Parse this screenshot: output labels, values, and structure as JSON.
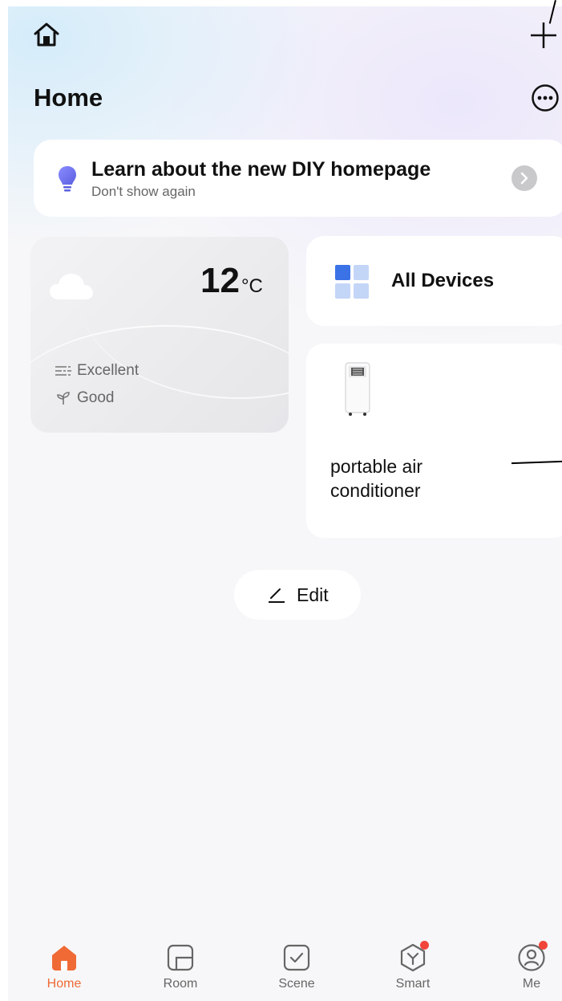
{
  "header": {
    "title": "Home"
  },
  "banner": {
    "title": "Learn about the new DIY homepage",
    "subtitle": "Don't show again"
  },
  "weather": {
    "temperature": "12",
    "unit": "°C",
    "air_quality": "Excellent",
    "plant": "Good"
  },
  "all_devices": {
    "label": "All Devices"
  },
  "device": {
    "name": "portable air conditioner"
  },
  "edit": {
    "label": "Edit"
  },
  "tabs": [
    {
      "label": "Home",
      "active": true
    },
    {
      "label": "Room"
    },
    {
      "label": "Scene"
    },
    {
      "label": "Smart",
      "badge": true
    },
    {
      "label": "Me",
      "badge": true
    }
  ],
  "colors": {
    "accent": "#f06a35",
    "badge": "#f2453a",
    "tile_blue": "#3b72e6"
  }
}
